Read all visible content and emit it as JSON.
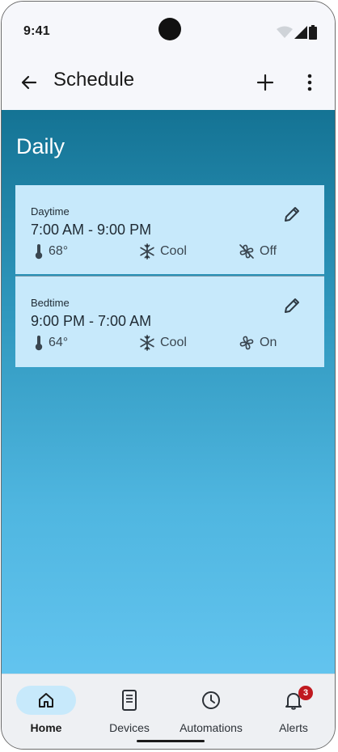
{
  "status_bar": {
    "time": "9:41"
  },
  "app_bar": {
    "title": "Schedule"
  },
  "section": {
    "title": "Daily"
  },
  "schedules": [
    {
      "label": "Daytime",
      "range": "7:00 AM - 9:00 PM",
      "temp": "68°",
      "mode": "Cool",
      "fan": "Off"
    },
    {
      "label": "Bedtime",
      "range": "9:00 PM - 7:00 AM",
      "temp": "64°",
      "mode": "Cool",
      "fan": "On"
    }
  ],
  "bottom_nav": {
    "items": [
      {
        "label": "Home",
        "icon": "home-icon",
        "active": true
      },
      {
        "label": "Devices",
        "icon": "device-icon",
        "active": false
      },
      {
        "label": "Automations",
        "icon": "clock-icon",
        "active": false
      },
      {
        "label": "Alerts",
        "icon": "bell-icon",
        "active": false,
        "badge": "3"
      }
    ]
  },
  "colors": {
    "accent": "#c7e9fb",
    "gradient_top": "#147394",
    "gradient_bottom": "#63c4ef",
    "badge": "#c0191f"
  }
}
